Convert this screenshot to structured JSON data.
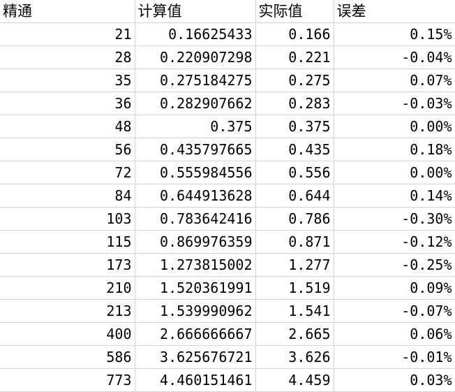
{
  "sheet": {
    "headers": [
      "精通",
      "计算值",
      "实际值",
      "误差"
    ],
    "rows": [
      [
        "21",
        "0.16625433",
        "0.166",
        "0.15%"
      ],
      [
        "28",
        "0.220907298",
        "0.221",
        "-0.04%"
      ],
      [
        "35",
        "0.275184275",
        "0.275",
        "0.07%"
      ],
      [
        "36",
        "0.282907662",
        "0.283",
        "-0.03%"
      ],
      [
        "48",
        "0.375",
        "0.375",
        "0.00%"
      ],
      [
        "56",
        "0.435797665",
        "0.435",
        "0.18%"
      ],
      [
        "72",
        "0.555984556",
        "0.556",
        "0.00%"
      ],
      [
        "84",
        "0.644913628",
        "0.644",
        "0.14%"
      ],
      [
        "103",
        "0.783642416",
        "0.786",
        "-0.30%"
      ],
      [
        "115",
        "0.869976359",
        "0.871",
        "-0.12%"
      ],
      [
        "173",
        "1.273815002",
        "1.277",
        "-0.25%"
      ],
      [
        "210",
        "1.520361991",
        "1.519",
        "0.09%"
      ],
      [
        "213",
        "1.539990962",
        "1.541",
        "-0.07%"
      ],
      [
        "400",
        "2.666666667",
        "2.665",
        "0.06%"
      ],
      [
        "586",
        "3.625676721",
        "3.626",
        "-0.01%"
      ],
      [
        "773",
        "4.460151461",
        "4.459",
        "0.03%"
      ]
    ]
  }
}
